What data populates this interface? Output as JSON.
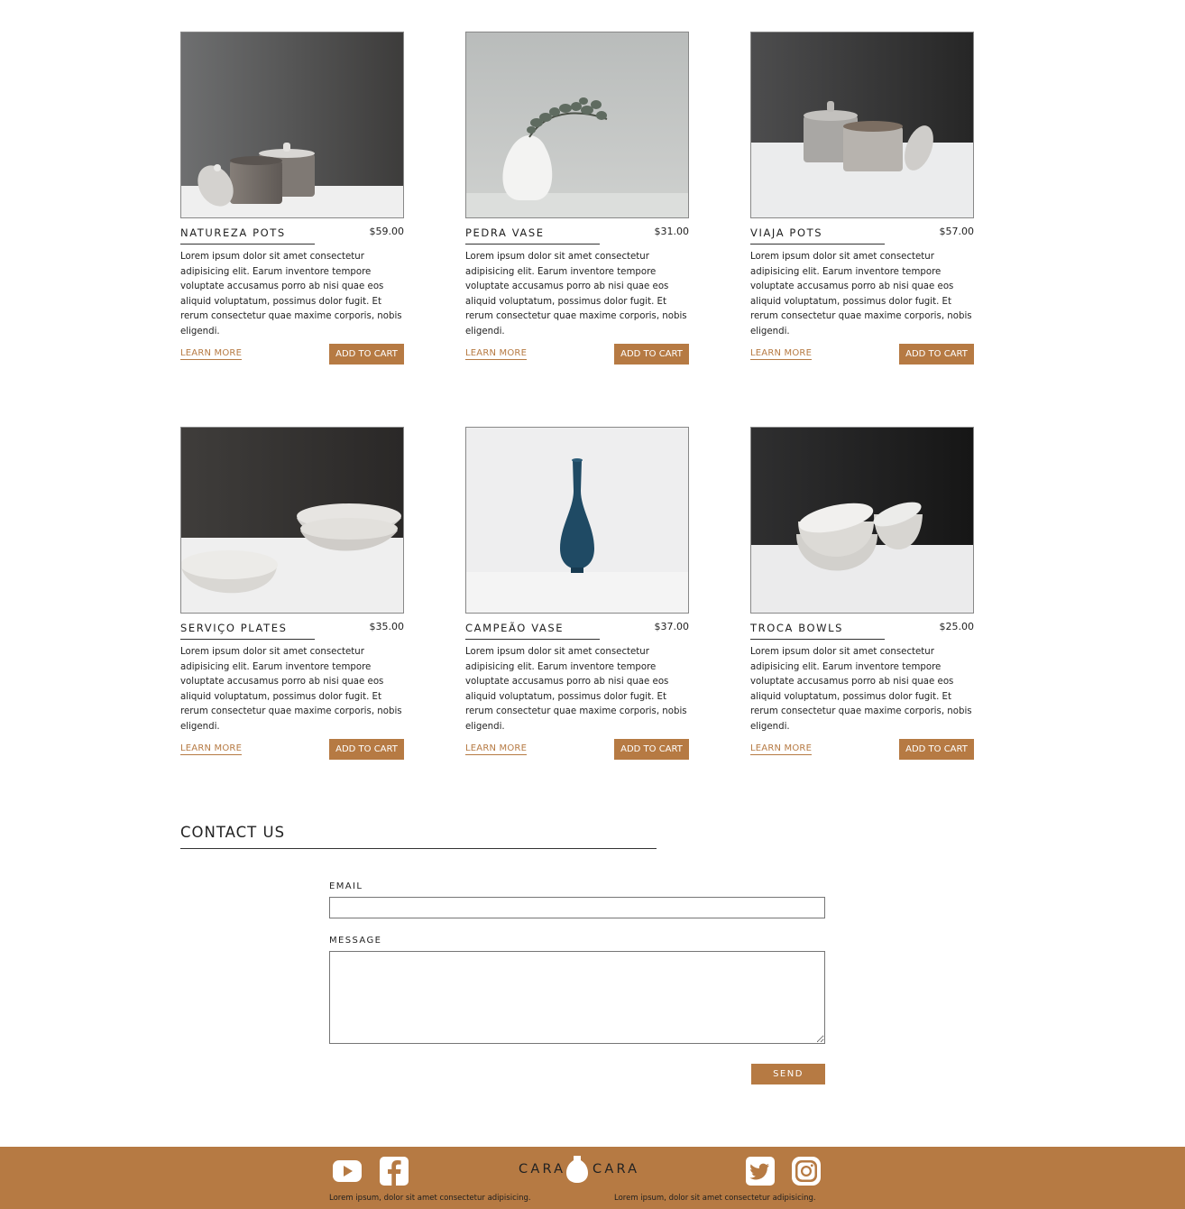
{
  "products": [
    {
      "name": "NATUREZA POTS",
      "price": "$59.00",
      "description": "Lorem ipsum dolor sit amet consectetur adipisicing elit. Earum inventore tempore voluptate accusamus porro ab nisi quae eos aliquid voluptatum, possimus dolor fugit. Et rerum consectetur quae maxime corporis, nobis eligendi.",
      "learn_more": "LEARN MORE",
      "add_to_cart": "ADD TO CART",
      "image": "grey-lidded-pots"
    },
    {
      "name": "PEDRA VASE",
      "price": "$31.00",
      "description": "Lorem ipsum dolor sit amet consectetur adipisicing elit. Earum inventore tempore voluptate accusamus porro ab nisi quae eos aliquid voluptatum, possimus dolor fugit. Et rerum consectetur quae maxime corporis, nobis eligendi.",
      "learn_more": "LEARN MORE",
      "add_to_cart": "ADD TO CART",
      "image": "white-vase-with-eucalyptus"
    },
    {
      "name": "VIAJA POTS",
      "price": "$57.00",
      "description": "Lorem ipsum dolor sit amet consectetur adipisicing elit. Earum inventore tempore voluptate accusamus porro ab nisi quae eos aliquid voluptatum, possimus dolor fugit. Et rerum consectetur quae maxime corporis, nobis eligendi.",
      "learn_more": "LEARN MORE",
      "add_to_cart": "ADD TO CART",
      "image": "stoneware-jars"
    },
    {
      "name": "SERVIÇO PLATES",
      "price": "$35.00",
      "description": "Lorem ipsum dolor sit amet consectetur adipisicing elit. Earum inventore tempore voluptate accusamus porro ab nisi quae eos aliquid voluptatum, possimus dolor fugit. Et rerum consectetur quae maxime corporis, nobis eligendi.",
      "learn_more": "LEARN MORE",
      "add_to_cart": "ADD TO CART",
      "image": "speckled-plates"
    },
    {
      "name": "CAMPEÃO VASE",
      "price": "$37.00",
      "description": "Lorem ipsum dolor sit amet consectetur adipisicing elit. Earum inventore tempore voluptate accusamus porro ab nisi quae eos aliquid voluptatum, possimus dolor fugit. Et rerum consectetur quae maxime corporis, nobis eligendi.",
      "learn_more": "LEARN MORE",
      "add_to_cart": "ADD TO CART",
      "image": "blue-bud-vase"
    },
    {
      "name": "TROCA BOWLS",
      "price": "$25.00",
      "description": "Lorem ipsum dolor sit amet consectetur adipisicing elit. Earum inventore tempore voluptate accusamus porro ab nisi quae eos aliquid voluptatum, possimus dolor fugit. Et rerum consectetur quae maxime corporis, nobis eligendi.",
      "learn_more": "LEARN MORE",
      "add_to_cart": "ADD TO CART",
      "image": "stacked-white-bowls"
    }
  ],
  "contact": {
    "title": "CONTACT US",
    "email_label": "EMAIL",
    "email_value": "",
    "message_label": "MESSAGE",
    "message_value": "",
    "send_label": "SEND"
  },
  "footer": {
    "brand_left": "CARA",
    "brand_right": "CARA",
    "text_left": "Lorem ipsum, dolor sit amet consectetur adipisicing.",
    "text_right": "Lorem ipsum, dolor sit amet consectetur adipisicing.",
    "social_icons": [
      "youtube-icon",
      "facebook-icon",
      "twitter-icon",
      "instagram-icon"
    ]
  },
  "colors": {
    "accent": "#b67a43",
    "text": "#222222",
    "background": "#ffffff"
  }
}
